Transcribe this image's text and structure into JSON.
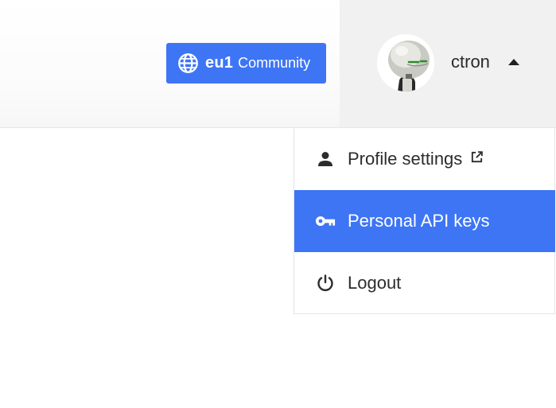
{
  "header": {
    "region_button": {
      "code": "eu1",
      "tier": "Community",
      "icon": "globe-icon",
      "background": "#3d75f5"
    },
    "user": {
      "name": "ctron",
      "avatar_icon": "robot-avatar",
      "caret_icon": "caret-up-icon",
      "background": "#f1f1f1"
    }
  },
  "user_menu": {
    "items": [
      {
        "label": "Profile settings",
        "icon": "person-icon",
        "trailing_icon": "external-link-icon",
        "active": false
      },
      {
        "label": "Personal API keys",
        "icon": "key-icon",
        "active": true
      },
      {
        "label": "Logout",
        "icon": "power-icon",
        "active": false
      }
    ],
    "active_color": "#3d75f5"
  }
}
